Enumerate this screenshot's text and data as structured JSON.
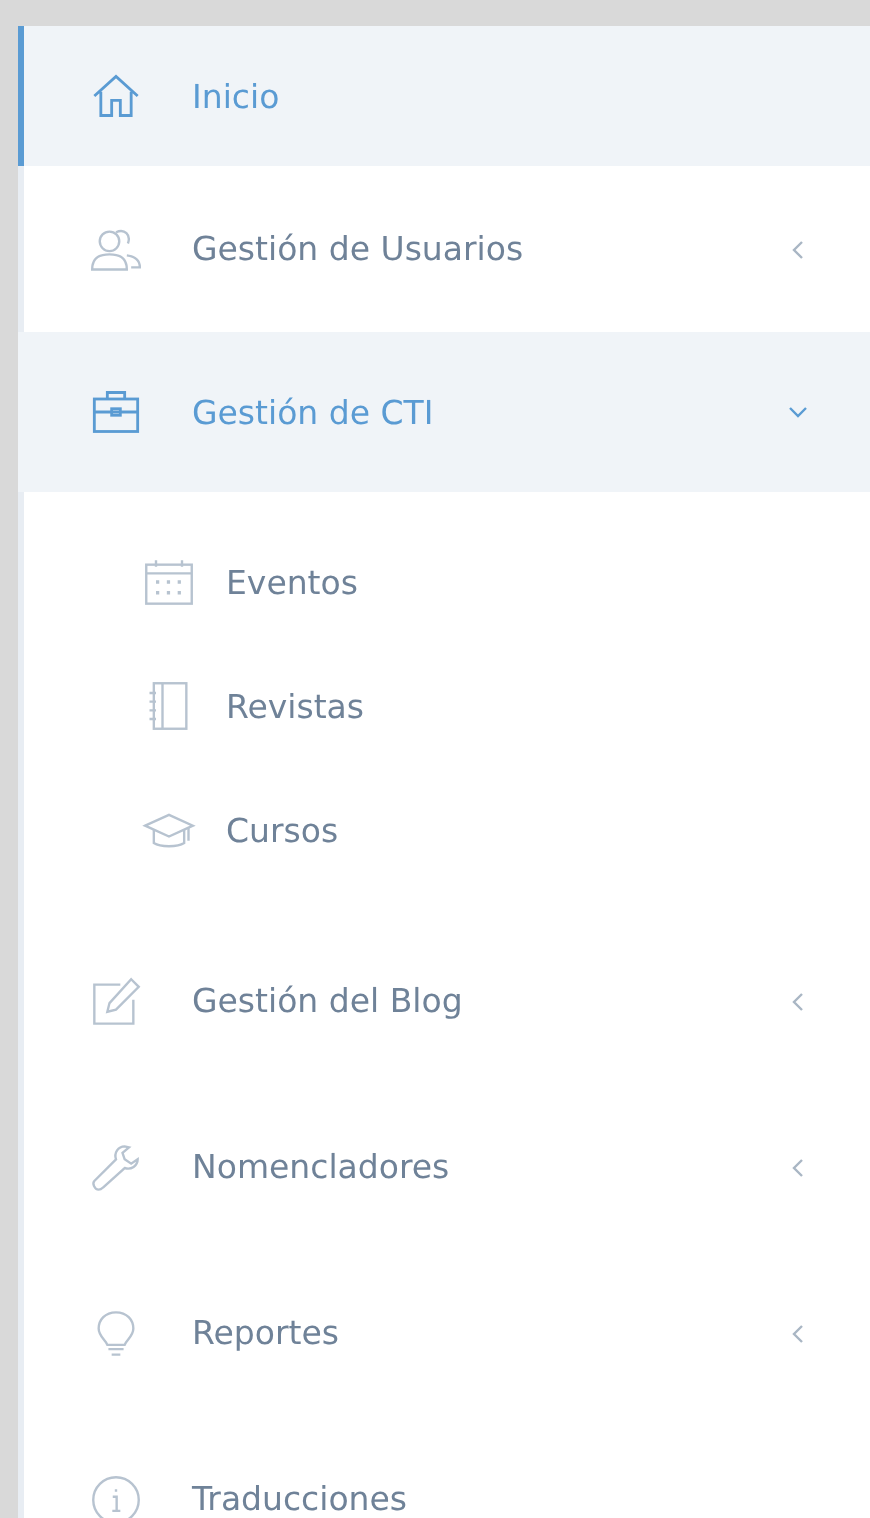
{
  "sidebar": {
    "items": [
      {
        "label": "Inicio",
        "selected": true
      },
      {
        "label": "Gestión de Usuarios",
        "selected": false,
        "expanded": false
      },
      {
        "label": "Gestión de CTI",
        "selected": false,
        "expanded": true,
        "children": [
          {
            "label": "Eventos"
          },
          {
            "label": "Revistas"
          },
          {
            "label": "Cursos"
          }
        ]
      },
      {
        "label": "Gestión del Blog",
        "selected": false,
        "expanded": false
      },
      {
        "label": "Nomencladores",
        "selected": false,
        "expanded": false
      },
      {
        "label": "Reportes",
        "selected": false,
        "expanded": false
      },
      {
        "label": "Traducciones",
        "selected": false
      }
    ]
  }
}
